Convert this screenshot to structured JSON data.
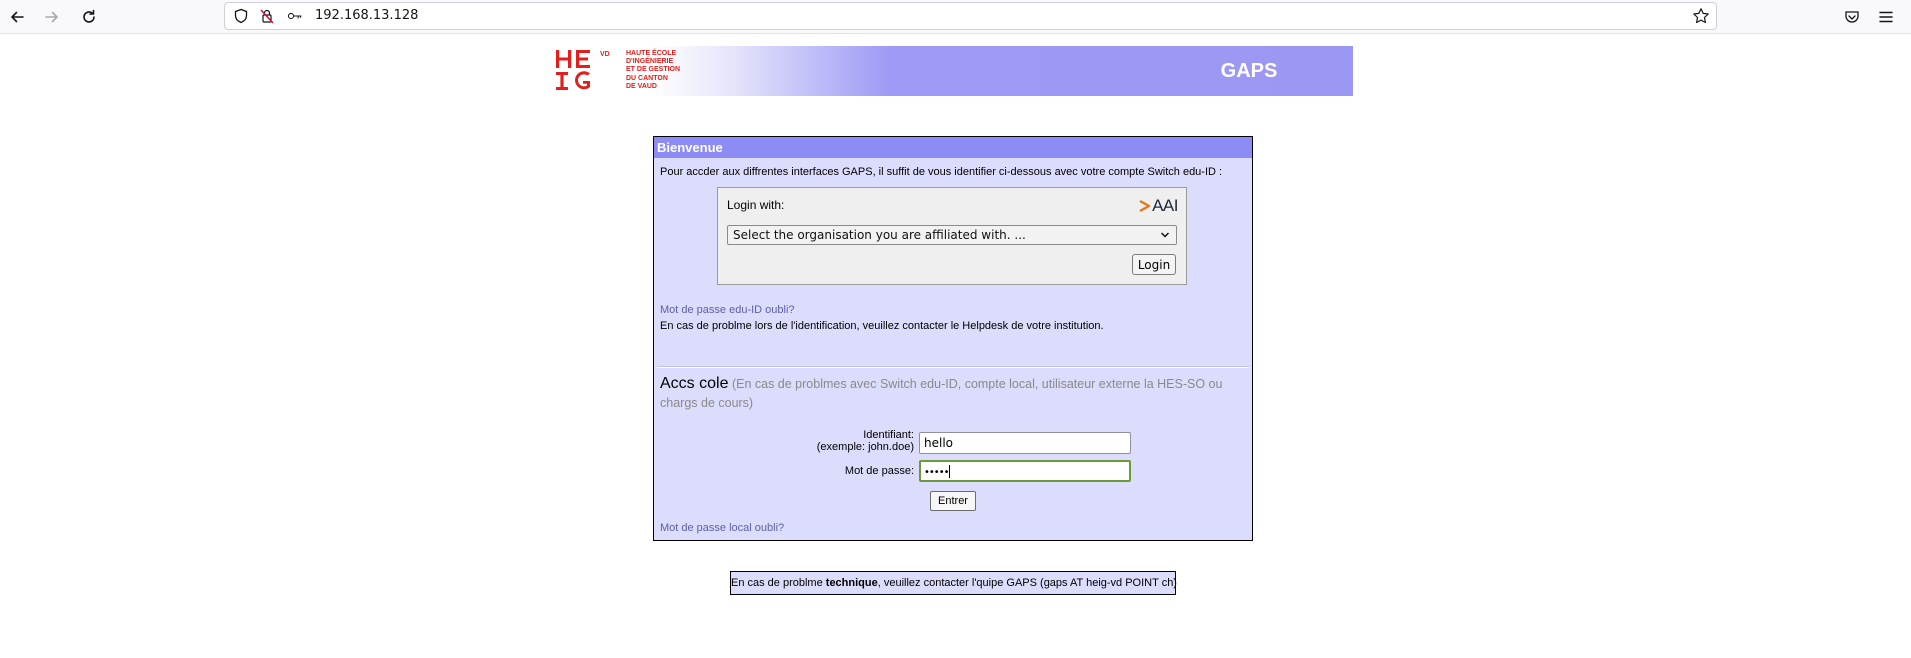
{
  "browser": {
    "url": "192.168.13.128",
    "icons": [
      "back-arrow-icon",
      "forward-arrow-icon",
      "reload-icon",
      "shield-icon",
      "permissions-blocked-icon",
      "key-icon",
      "bookmark-star-icon",
      "pocket-icon",
      "hamburger-menu-icon"
    ]
  },
  "banner": {
    "logo_mark": "HEIG VD",
    "logo_lines": [
      "HAUTE ÉCOLE",
      "D'INGÉNIERIE",
      "ET DE GESTION",
      "DU CANTON",
      "DE VAUD"
    ],
    "title": "GAPS"
  },
  "panel": {
    "header": "Bienvenue",
    "intro": "Pour accder aux diffrentes interfaces GAPS, il suffit de vous identifier ci-dessous avec votre compte Switch edu-ID :",
    "sso": {
      "login_with": "Login with:",
      "aai_label": "AAI",
      "select_value": "Select the organisation you are affiliated with. ...",
      "login_button": "Login"
    },
    "forgot_eduid": "Mot de passe edu-ID oubli?",
    "helpdesk": "En cas de problme lors de l'identification, veuillez contacter le Helpdesk de votre institution.",
    "acces": {
      "title": "Accs cole",
      "note": "(En cas de problmes avec Switch edu-ID, compte local, utilisateur externe la HES-SO ou chargs de cours)"
    },
    "form": {
      "id_label": "Identifiant:",
      "id_example": "(exemple: john.doe)",
      "id_value": "hello",
      "password_label": "Mot de passe:",
      "password_value": "•••••",
      "submit": "Entrer"
    },
    "forgot_local": "Mot de passe local oubli?"
  },
  "footer": {
    "prefix": "En cas de problme ",
    "bold": "technique",
    "suffix": ", veuillez contacter l'quipe GAPS (gaps AT heig-vd POINT ch)"
  },
  "colors": {
    "panel_bg": "#dcdcfc",
    "header_bg": "#8c8cf4",
    "banner_purple": "#9b98f4",
    "logo_red": "#e0201c"
  }
}
